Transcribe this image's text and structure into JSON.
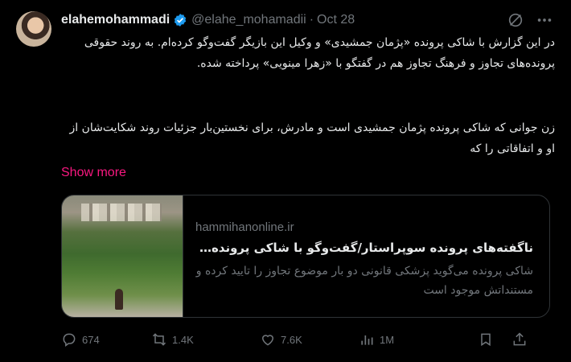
{
  "tweet": {
    "display_name": "elahemohammadi",
    "handle": "@elahe_mohamadii",
    "separator": "·",
    "time": "Oct 28",
    "paragraph_1": "در این گزارش با شاکی پرونده «پژمان جمشیدی» و وکیل این بازیگر گفت‌وگو کرده‌ام. به روند حقوقی پرونده‌های تجاوز و فرهنگ تجاوز هم در گفتگو با «زهرا مینویی» پرداخته شده.",
    "paragraph_2": "زن جوانی که شاکی پرونده پژمان جمشیدی است و مادرش، برای نخستین‌بار جزئیات روند شکایت‌شان از او و اتفاقاتی را که",
    "show_more": "Show more"
  },
  "link_card": {
    "domain": "hammihanonline.ir",
    "title": "ناگفته‌های پرونده سوپراستار/گفت‌وگو با شاکی پرونده «پژم...",
    "description": "شاکی پرونده می‌گوید پزشکی قانونی دو بار موضوع تجاوز را تایید کرده و مستنداتش موجود است"
  },
  "actions": {
    "replies": "674",
    "reposts": "1.4K",
    "likes": "7.6K",
    "views": "1M"
  },
  "icons": {
    "verified": "verified-badge-icon",
    "grok": "grok-icon",
    "more": "more-options-icon",
    "reply": "reply-icon",
    "repost": "repost-icon",
    "like": "heart-icon",
    "views": "views-chart-icon",
    "bookmark": "bookmark-icon",
    "share": "share-icon"
  },
  "colors": {
    "background": "#000000",
    "text": "#e7e9ea",
    "muted": "#71767b",
    "verified": "#1d9bf0",
    "show_more": "#f91880",
    "border": "#2f3336"
  }
}
